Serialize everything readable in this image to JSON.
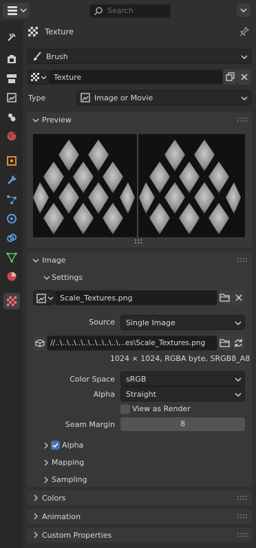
{
  "search": {
    "placeholder": "Search"
  },
  "header": {
    "title": "Texture"
  },
  "brush_selector": {
    "value": "Brush"
  },
  "texture_block": {
    "name": "Texture"
  },
  "type_row": {
    "label": "Type",
    "value": "Image or Movie"
  },
  "preview": {
    "title": "Preview"
  },
  "image_panel": {
    "title": "Image",
    "settings_title": "Settings",
    "image_name": "Scale_Textures.png",
    "source_label": "Source",
    "source_value": "Single Image",
    "filepath": "//..\\..\\..\\..\\..\\..\\..\\..\\..\\...es\\Scale_Textures.png",
    "info": "1024 × 1024,  RGBA byte, SRGB8_A8",
    "colorspace_label": "Color Space",
    "colorspace_value": "sRGB",
    "alpha_label": "Alpha",
    "alpha_value": "Straight",
    "view_as_render_label": "View as Render",
    "view_as_render": false,
    "seam_margin_label": "Seam Margin",
    "seam_margin_value": "8",
    "subpanels": [
      {
        "label": "Alpha",
        "checked": true
      },
      {
        "label": "Mapping"
      },
      {
        "label": "Sampling"
      }
    ]
  },
  "collapsed_panels": [
    "Colors",
    "Animation",
    "Custom Properties"
  ],
  "colors": {
    "accent": "#4772b3",
    "bg": "#303030",
    "panel": "#383838",
    "field": "#1d1d1d"
  }
}
